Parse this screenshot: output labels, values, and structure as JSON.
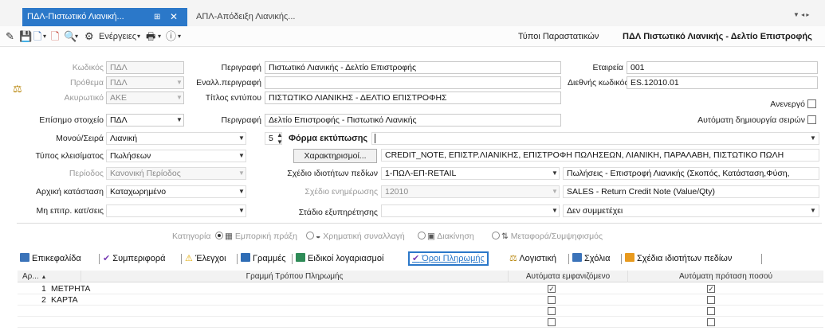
{
  "tabs": [
    {
      "label": "ΠΔΛ-Πιστωτικό Λιανική..."
    },
    {
      "label": "ΑΠΛ-Απόδειξη Λιανικής..."
    }
  ],
  "toolbar": {
    "actions_label": "Ενέργειες",
    "doc_types_label": "Τύποι Παραστατικών",
    "doc_title": "ΠΔΛ Πιστωτικό Λιανικής - Δελτίο Επιστροφής"
  },
  "form": {
    "code": {
      "label": "Κωδικός",
      "value": "ΠΔΛ"
    },
    "prefix": {
      "label": "Πρόθεμα",
      "value": "ΠΔΛ"
    },
    "cancel": {
      "label": "Ακυρωτικό",
      "value": "ΑΚΕ"
    },
    "official": {
      "label": "Επίσημο στοιχείο",
      "value": "ΠΔΛ"
    },
    "description": {
      "label": "Περιγραφή",
      "value": "Πιστωτικό Λιανικής - Δελτίο Επιστροφής"
    },
    "alt_description": {
      "label": "Εναλλ.περιγραφή",
      "value": ""
    },
    "print_title": {
      "label": "Τίτλος εντύπου",
      "value": "ΠΙΣΤΩΤΙΚΟ ΛΙΑΝΙΚΗΣ - ΔΕΛΤΙΟ ΕΠΙΣΤΡΟΦΗΣ"
    },
    "description2": {
      "label": "Περιγραφή",
      "value": "Δελτίο Επιστροφής - Πιστωτικό Λιανικής"
    },
    "company": {
      "label": "Εταιρεία",
      "value": "001"
    },
    "intl_code": {
      "label": "Διεθνής κωδικός",
      "value": "ES.12010.01"
    },
    "inactive": {
      "label": "Ανενεργό"
    },
    "auto_series": {
      "label": "Αυτόματη δημιουργία σειρών"
    },
    "unit_series": {
      "label": "Μονού/Σειρά",
      "value": "Λιανική"
    },
    "copies": "5",
    "print_form": {
      "label": "Φόρμα εκτύπωσης",
      "value": ""
    },
    "closing_type": {
      "label": "Τύπος κλεισίματος",
      "value": "Πωλήσεων"
    },
    "characterizations_button": "Χαρακτηρισμοί...",
    "characterizations_value": "CREDIT_NOTE, ΕΠΙΣΤΡ.ΛΙΑΝΙΚΗΣ, ΕΠΙΣΤΡΟΦΗ ΠΩΛΗΣΕΩΝ, ΛΙΑΝΙΚΗ, ΠΑΡΑΛΑΒΗ, ΠΙΣΤΩΤΙΚΟ ΠΩΛΗ",
    "period": {
      "label": "Περίοδος",
      "value": "Κανονική Περίοδος"
    },
    "field_props_plan": {
      "label": "Σχέδιο ιδιοτήτων πεδίων",
      "value": "1-ΠΩΛ-ΕΠ-RETAIL"
    },
    "field_props_desc": "Πωλήσεις - Επιστροφή Λιανικής (Σκοπός, Κατάσταση,Φύση,",
    "initial_state": {
      "label": "Αρχική κατάσταση",
      "value": "Καταχωρημένο"
    },
    "update_plan": {
      "label": "Σχέδιο ενημέρωσης",
      "value": "12010"
    },
    "update_desc": "SALES - Return Credit Note (Value/Qty)",
    "no_permit": {
      "label": "Μη επιτρ. κατ/σεις",
      "value": ""
    },
    "service_stage": {
      "label": "Στάδιο εξυπηρέτησης",
      "value": ""
    },
    "not_participate": "Δεν συμμετέχει"
  },
  "category": {
    "label": "Κατηγορία",
    "options": [
      "Εμπορική πράξη",
      "Χρηματική συναλλαγή",
      "Διακίνηση",
      "Μεταφορά/Συμψηφισμός"
    ]
  },
  "subtabs": [
    {
      "label": "Επικεφαλίδα"
    },
    {
      "label": "Συμπεριφορά"
    },
    {
      "label": "Έλεγχοι"
    },
    {
      "label": "Γραμμές"
    },
    {
      "label": "Ειδικοί λογαριασμοί"
    },
    {
      "label": "Όροι Πληρωμής"
    },
    {
      "label": "Λογιστική"
    },
    {
      "label": "Σχόλια"
    },
    {
      "label": "Σχέδια ιδιοτήτων πεδίων"
    }
  ],
  "grid": {
    "columns": [
      "Αρ...",
      "Γραμμή Τρόπου Πληρωμής",
      "Αυτόματα εμφανιζόμενο",
      "Αυτόματη πρόταση ποσού"
    ],
    "rows": [
      {
        "num": "1",
        "name": "ΜΕΤΡΗΤΑ",
        "auto_show": true,
        "auto_amount": true
      },
      {
        "num": "2",
        "name": "ΚΑΡΤΑ",
        "auto_show": false,
        "auto_amount": false
      },
      {
        "num": "",
        "name": "",
        "auto_show": false,
        "auto_amount": false
      },
      {
        "num": "",
        "name": "",
        "auto_show": false,
        "auto_amount": false
      }
    ]
  },
  "colors": {
    "accent": "#2b78c9"
  }
}
